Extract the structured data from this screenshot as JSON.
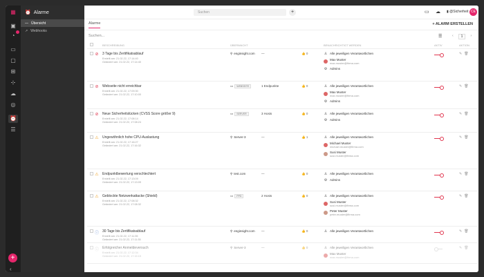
{
  "app": {
    "title": "Alarme"
  },
  "nav": {
    "items": [
      {
        "label": "Übersicht"
      },
      {
        "label": "Webhooks"
      }
    ]
  },
  "topbar": {
    "search_placeholder": "Suchen",
    "company": "@Sicherheit",
    "avatar_initials": "CE"
  },
  "page": {
    "tab": "Alarme",
    "create_button": "+ ALARM ERSTELLEN",
    "search_placeholder": "Suchen...",
    "page_number": "1"
  },
  "columns": {
    "description": "Beschreibung",
    "source": "Überwacht",
    "triggers": "",
    "count": "",
    "notify": "Benachrichtigt werden",
    "active": "Aktiv",
    "action": "Aktion"
  },
  "rows": [
    {
      "status": "red",
      "title": "3 Tage bis Zertifikatsablauf",
      "created": "Erstellt am:   21.02.22, 17:14:40",
      "modified": "Geändert am:   21.02.22, 17:14:40",
      "source": "enginsight.com",
      "tag": "",
      "trigger": "—",
      "count": "0",
      "notify_all": "Alle jeweiligen Verantwortlichen",
      "people": [
        {
          "name": "Max Muster",
          "mail": "max.muster@firma.com"
        }
      ],
      "group": "Admins",
      "active": true
    },
    {
      "status": "red",
      "title": "Webseite nicht erreichbar",
      "created": "Erstellt am:   21.02.22, 17:09:30",
      "modified": "Geändert am:   21.02.22, 17:10:00",
      "source": "",
      "tag": "WEBSEITE",
      "trigger": "1 Endpunkte",
      "count": "0",
      "notify_all": "Alle jeweiligen Verantwortlichen",
      "people": [
        {
          "name": "Max Muster",
          "mail": "max.muster@firma.com"
        }
      ],
      "group": "Admins",
      "active": true
    },
    {
      "status": "red",
      "title": "Neue Sicherheitslücken (CVSS Score größer 9)",
      "created": "Erstellt am:   21.02.22, 17:08:14",
      "modified": "Geändert am:   21.02.22, 17:08:24",
      "source": "",
      "tag": "SERVER",
      "trigger": "3 Hosts",
      "count": "0",
      "notify_all": "Alle jeweiligen Verantwortlichen",
      "people": [],
      "group": "Admins",
      "active": true
    },
    {
      "status": "orange",
      "title": "Ungewöhnlich hohe CPU-Auslastung",
      "created": "Erstellt am:   21.02.22, 17:16:27",
      "modified": "Geändert am:   21.02.22, 17:16:32",
      "source": "Server-3",
      "tag": "",
      "trigger": "—",
      "count": "1",
      "notify_all": "Alle jeweiligen Verantwortlichen",
      "people": [
        {
          "name": "Michael Muster",
          "mail": "michael.muster@firma.com"
        },
        {
          "name": "Susi Muster",
          "mail": "susi.muster@firma.com"
        }
      ],
      "group": "",
      "active": true
    },
    {
      "status": "orange",
      "title": "Endpunktbewertung verschlechtert",
      "created": "Erstellt am:   21.02.22, 17:13:09",
      "modified": "Geändert am:   21.02.22, 17:13:09",
      "source": "test.com",
      "tag": "",
      "trigger": "—",
      "count": "0",
      "notify_all": "Alle jeweiligen Verantwortlichen",
      "people": [],
      "group": "Admins",
      "active": true
    },
    {
      "status": "orange",
      "title": "Geblockte Netzwerkattacke (Shield)",
      "created": "Erstellt am:   21.02.22, 17:08:32",
      "modified": "Geändert am:   21.02.22, 17:08:32",
      "source": "",
      "tag": "PPD",
      "trigger": "2 Hosts",
      "count": "0",
      "notify_all": "Alle jeweiligen Verantwortlichen",
      "people": [
        {
          "name": "Susi Muster",
          "mail": "susi.muster@firma.com"
        },
        {
          "name": "Peter Muster",
          "mail": "peter.muster@firma.com"
        }
      ],
      "group": "",
      "active": true
    },
    {
      "status": "blue",
      "title": "30 Tage bis Zertifikatsablauf",
      "created": "Erstellt am:   21.02.22, 17:11:35",
      "modified": "Geändert am:   21.02.22, 17:11:35",
      "source": "enginsight.com",
      "tag": "",
      "trigger": "—",
      "count": "0",
      "notify_all": "Alle jeweiligen Verantwortlichen",
      "people": [],
      "group": "",
      "active": true
    },
    {
      "status": "grey",
      "title": "Erfolgreicher Anmeldeversuch",
      "created": "Erstellt am:   21.02.22, 17:12:34",
      "modified": "Geändert am:   21.02.22, 17:15:15",
      "source": "Server-3",
      "tag": "",
      "trigger": "—",
      "count": "0",
      "notify_all": "Alle jeweiligen Verantwortlichen",
      "people": [
        {
          "name": "Max Muster",
          "mail": "max.muster@firma.com"
        }
      ],
      "group": "",
      "active": false
    }
  ],
  "colors": {
    "accent": "#e5266b",
    "alert_red": "#e0344d",
    "warn_orange": "#f0a020",
    "info_blue": "#6a8fd4"
  }
}
